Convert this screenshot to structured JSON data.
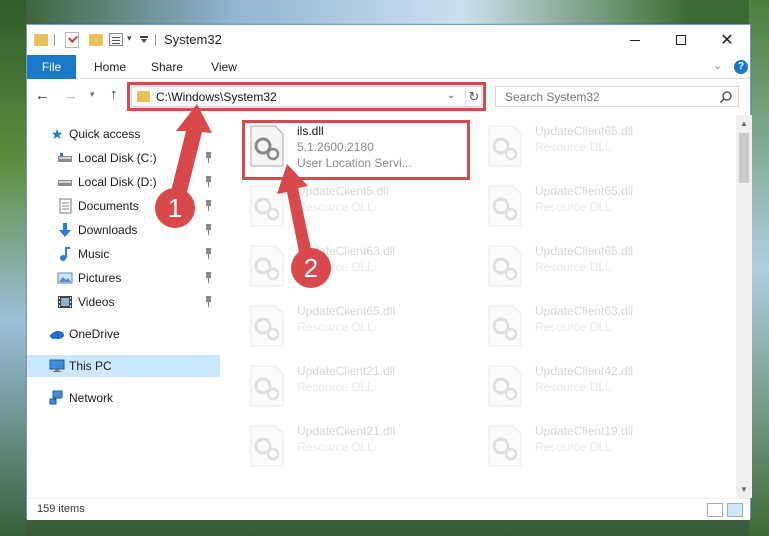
{
  "window": {
    "title": "System32"
  },
  "ribbon": {
    "tabs": [
      "File",
      "Home",
      "Share",
      "View"
    ],
    "help": "?"
  },
  "navigation": {
    "address": "C:\\Windows\\System32",
    "search_placeholder": "Search System32"
  },
  "sidebar": {
    "quick_access": "Quick access",
    "items": [
      {
        "label": "Local Disk (C:)",
        "icon": "drive-icon",
        "pinned": true
      },
      {
        "label": "Local Disk (D:)",
        "icon": "drive-icon",
        "pinned": true
      },
      {
        "label": "Documents",
        "icon": "documents-icon",
        "pinned": true
      },
      {
        "label": "Downloads",
        "icon": "download-icon",
        "pinned": true
      },
      {
        "label": "Music",
        "icon": "music-icon",
        "pinned": true
      },
      {
        "label": "Pictures",
        "icon": "pictures-icon",
        "pinned": true
      },
      {
        "label": "Videos",
        "icon": "videos-icon",
        "pinned": true
      }
    ],
    "onedrive": "OneDrive",
    "this_pc": "This PC",
    "network": "Network"
  },
  "files": {
    "main": {
      "name": "ils.dll",
      "version": "5.1.2600.2180",
      "description": "User Location Servi..."
    },
    "left_column": [
      {
        "name": "UpdateClient5.dll",
        "type": "Resource DLL"
      },
      {
        "name": "UpdateClient63.dll",
        "type": "Resource DLL"
      },
      {
        "name": "UpdateClient65.dll",
        "type": "Resource DLL"
      },
      {
        "name": "UpdateClient21.dll",
        "type": "Resource DLL"
      },
      {
        "name": "UpdateClient21.dll",
        "type": "Resource DLL"
      }
    ],
    "right_column": [
      {
        "name": "UpdateClient65.dll",
        "type": "Resource DLL"
      },
      {
        "name": "UpdateClient65.dll",
        "type": "Resource DLL"
      },
      {
        "name": "UpdateClient65.dll",
        "type": "Resource DLL"
      },
      {
        "name": "UpdateClient63.dll",
        "type": "Resource DLL"
      },
      {
        "name": "UpdateClient42.dll",
        "type": "Resource DLL"
      },
      {
        "name": "UpdateClient19.dll",
        "type": "Resource DLL"
      }
    ]
  },
  "status": {
    "item_count": "159 items"
  },
  "annotations": {
    "badge1": "1",
    "badge2": "2",
    "color": "#d9494b"
  }
}
